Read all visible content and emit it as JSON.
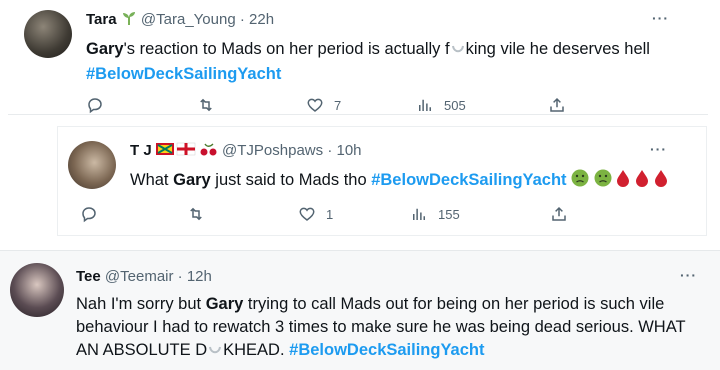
{
  "tweets": [
    {
      "name": "Tara",
      "emoji_after_name": "seedling-icon",
      "handle": "@Tara_Young",
      "sep": "·",
      "time": "22h",
      "text_parts": [
        "Gary",
        "'s reaction to Mads on her period is actually f",
        "king vile he deserves hell ",
        "#BelowDeckSailingYacht"
      ],
      "replies": "",
      "retweets": "",
      "likes": "7",
      "views": "505"
    },
    {
      "name": "T J",
      "emoji_after_name": "flags-icon",
      "handle": "@TJPoshpaws",
      "sep": "·",
      "time": "10h",
      "text_parts": [
        "What ",
        "Gary",
        " just said to Mads tho ",
        "#BelowDeckSailingYacht"
      ],
      "replies": "",
      "retweets": "",
      "likes": "1",
      "views": "155"
    },
    {
      "name": "Tee",
      "handle": "@Teemair",
      "sep": "·",
      "time": "12h",
      "text_parts": [
        "Nah I'm sorry but ",
        "Gary",
        " trying to call Mads out for being on her period is such vile behaviour I had to rewatch 3 times to make sure he was being dead serious. WHAT AN ABSOLUTE D",
        "KHEAD. ",
        "#BelowDeckSailingYacht"
      ]
    }
  ],
  "more_label": "···",
  "colors": {
    "accent": "#1d9bf0",
    "muted": "#536471",
    "text": "#0f1419"
  },
  "icons": [
    "reply-icon",
    "retweet-icon",
    "like-icon",
    "views-icon",
    "share-icon"
  ]
}
